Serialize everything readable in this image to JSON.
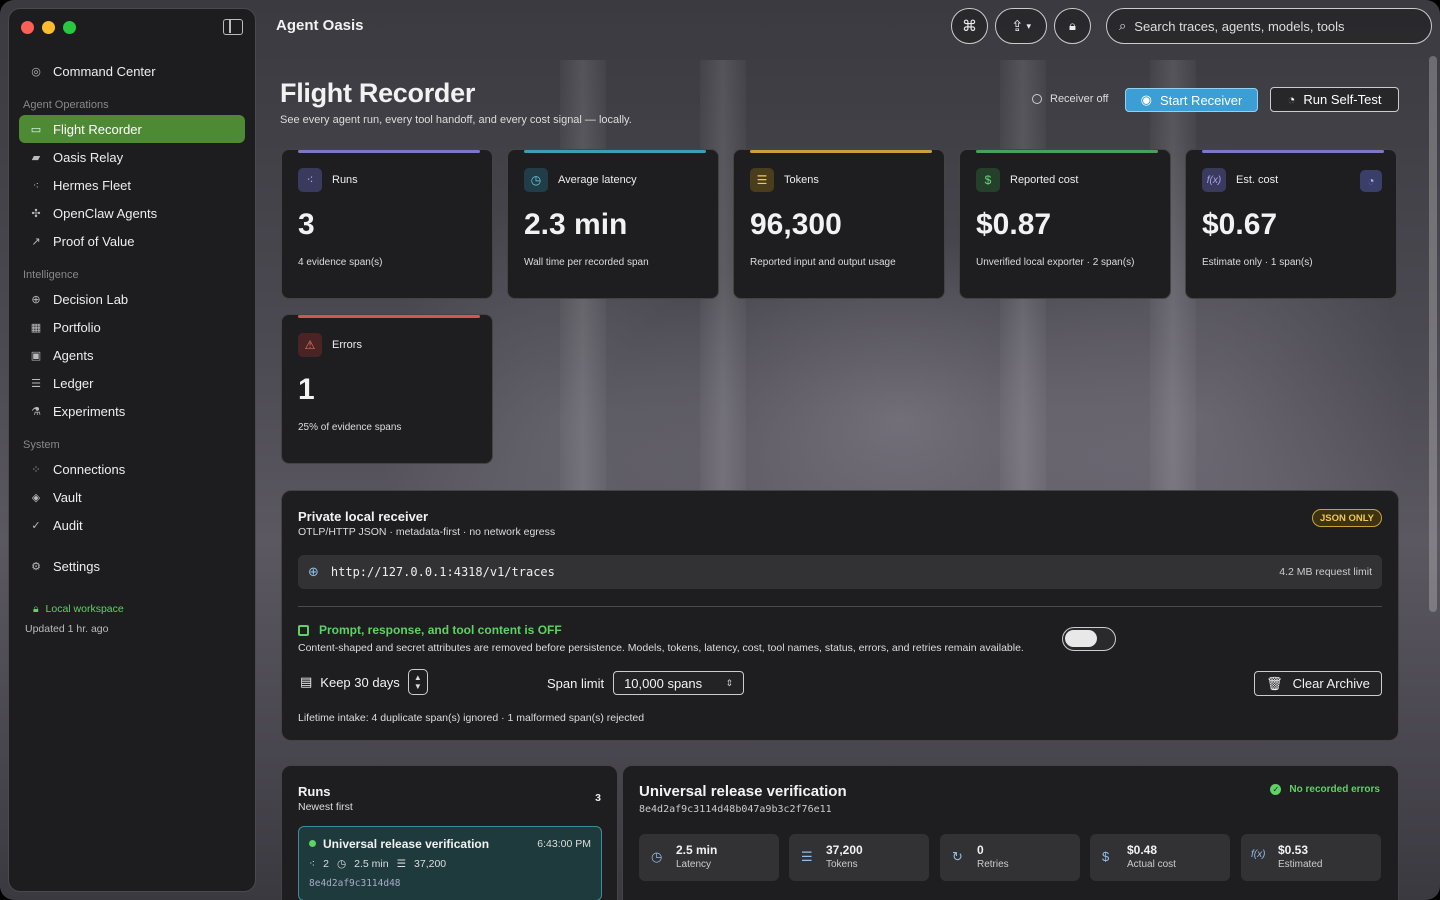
{
  "app": {
    "title": "Agent Oasis"
  },
  "colors": {
    "accent_green": "#4e8a34",
    "accent_blue": "#3b9fd6",
    "success": "#5ed264",
    "warning": "#f0c94a"
  },
  "sidebar": {
    "top_item": {
      "label": "Command Center",
      "icon": "compass-icon"
    },
    "sections": [
      {
        "title": "Agent Operations",
        "items": [
          {
            "label": "Flight Recorder",
            "icon": "waveform-icon",
            "active": true
          },
          {
            "label": "Oasis Relay",
            "icon": "chat-bubbles-icon"
          },
          {
            "label": "Hermes Fleet",
            "icon": "nodes-icon"
          },
          {
            "label": "OpenClaw Agents",
            "icon": "paw-icon"
          },
          {
            "label": "Proof of Value",
            "icon": "trend-chart-icon"
          }
        ]
      },
      {
        "title": "Intelligence",
        "items": [
          {
            "label": "Decision Lab",
            "icon": "crosshair-icon"
          },
          {
            "label": "Portfolio",
            "icon": "grid-icon"
          },
          {
            "label": "Agents",
            "icon": "chip-icon"
          },
          {
            "label": "Ledger",
            "icon": "list-icon"
          },
          {
            "label": "Experiments",
            "icon": "flask-icon"
          }
        ]
      },
      {
        "title": "System",
        "items": [
          {
            "label": "Connections",
            "icon": "network-icon"
          },
          {
            "label": "Vault",
            "icon": "shield-icon"
          },
          {
            "label": "Audit",
            "icon": "check-circle-icon"
          }
        ]
      }
    ],
    "settings": {
      "label": "Settings",
      "icon": "gear-icon"
    },
    "workspace": {
      "label": "Local workspace",
      "updated": "Updated 1 hr. ago"
    }
  },
  "toolbar": {
    "search_placeholder": "Search traces, agents, models, tools"
  },
  "header": {
    "title": "Flight Recorder",
    "subtitle": "See every agent run, every tool handoff, and every cost signal — locally.",
    "receiver_status": "Receiver off",
    "start_label": "Start Receiver",
    "selftest_label": "Run Self-Test"
  },
  "metrics": [
    {
      "label": "Runs",
      "value": "3",
      "note": "4 evidence span(s)",
      "icon": "nodes-icon",
      "color": "#7c78c4"
    },
    {
      "label": "Average latency",
      "value": "2.3 min",
      "note": "Wall time per recorded span",
      "icon": "clock-icon",
      "color": "#3a9fb0"
    },
    {
      "label": "Tokens",
      "value": "96,300",
      "note": "Reported input and output usage",
      "icon": "lines-icon",
      "color": "#c9a03a"
    },
    {
      "label": "Reported cost",
      "value": "$0.87",
      "note": "Unverified local exporter · 2 span(s)",
      "icon": "dollar-icon",
      "color": "#4aa05a"
    },
    {
      "label": "Est. cost",
      "value": "$0.67",
      "note": "Estimate only · 1 span(s)",
      "icon": "function-icon",
      "color": "#7c78c4"
    },
    {
      "label": "Errors",
      "value": "1",
      "note": "25% of evidence spans",
      "icon": "warning-icon",
      "color": "#d9534f"
    }
  ],
  "receiver": {
    "title": "Private local receiver",
    "subtitle": "OTLP/HTTP JSON · metadata-first · no network egress",
    "badge": "JSON ONLY",
    "url": "http://127.0.0.1:4318/v1/traces",
    "request_limit": "4.2 MB request limit",
    "privacy_title": "Prompt, response, and tool content is OFF",
    "privacy_note": "Content-shaped and secret attributes are removed before persistence. Models, tokens, latency, cost, tool names, status, errors, and retries remain available.",
    "keep_label": "Keep 30 days",
    "span_limit_label": "Span limit",
    "span_limit_value": "10,000 spans",
    "clear_label": "Clear Archive",
    "lifetime": "Lifetime intake: 4 duplicate span(s) ignored · 1 malformed span(s) rejected"
  },
  "runs": {
    "title": "Runs",
    "subtitle": "Newest first",
    "count": "3",
    "items": [
      {
        "name": "Universal release verification",
        "time": "6:43:00 PM",
        "spans": "2",
        "latency": "2.5 min",
        "tokens": "37,200",
        "hash": "8e4d2af9c3114d48"
      }
    ]
  },
  "detail": {
    "title": "Universal release verification",
    "hash": "8e4d2af9c3114d48b047a9b3c2f76e11",
    "status": "No recorded errors",
    "stats": [
      {
        "value": "2.5 min",
        "label": "Latency",
        "icon": "clock-icon"
      },
      {
        "value": "37,200",
        "label": "Tokens",
        "icon": "lines-icon"
      },
      {
        "value": "0",
        "label": "Retries",
        "icon": "retry-icon"
      },
      {
        "value": "$0.48",
        "label": "Actual cost",
        "icon": "dollar-icon"
      },
      {
        "value": "$0.53",
        "label": "Estimated",
        "icon": "function-icon"
      }
    ]
  }
}
